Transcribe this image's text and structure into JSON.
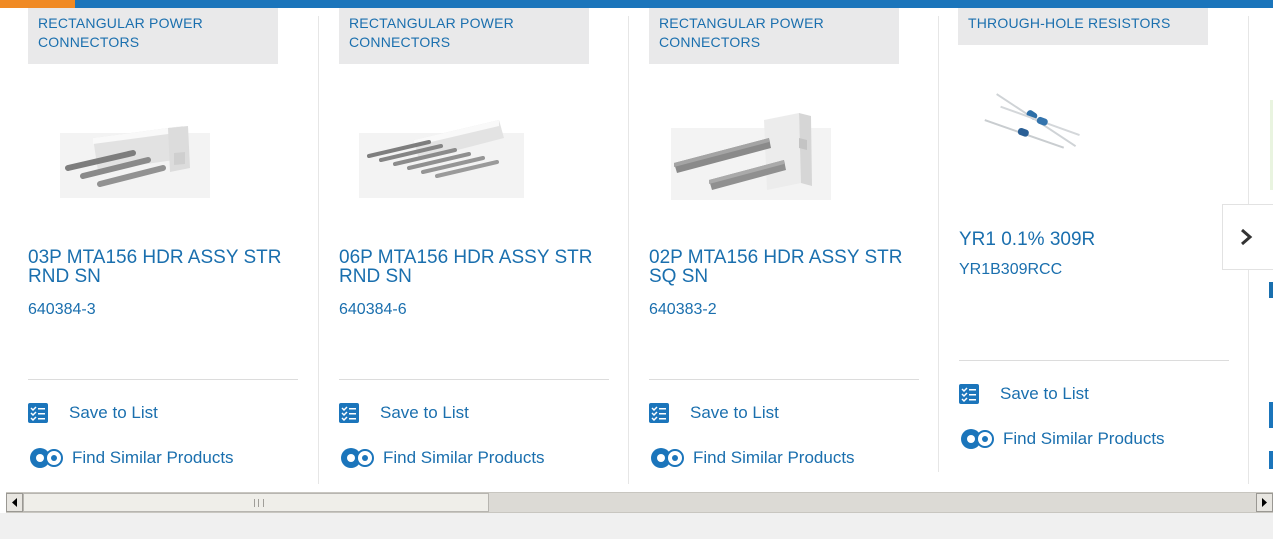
{
  "cards": [
    {
      "category": "RECTANGULAR POWER CONNECTORS",
      "name": "03P MTA156 HDR ASSY STR RND SN",
      "part_number": "640384-3",
      "save_label": "Save to List",
      "similar_label": "Find Similar Products"
    },
    {
      "category": "RECTANGULAR POWER CONNECTORS",
      "name": "06P MTA156 HDR ASSY STR RND SN",
      "part_number": "640384-6",
      "save_label": "Save to List",
      "similar_label": "Find Similar Products"
    },
    {
      "category": "RECTANGULAR POWER CONNECTORS",
      "name": "02P MTA156 HDR ASSY STR SQ SN",
      "part_number": "640383-2",
      "save_label": "Save to List",
      "similar_label": "Find Similar Products"
    },
    {
      "category": "THROUGH-HOLE RESISTORS",
      "name": "YR1 0.1% 309R",
      "part_number": "YR1B309RCC",
      "save_label": "Save to List",
      "similar_label": "Find Similar Products"
    }
  ],
  "icons": {
    "save": "checklist-icon",
    "similar": "gears-icon",
    "next": "chevron-right-icon",
    "scroll_left": "arrow-left-icon",
    "scroll_right": "arrow-right-icon"
  },
  "colors": {
    "accent_blue": "#1b75bb",
    "link_blue": "#1a6fae",
    "accent_orange": "#f08a24",
    "category_bg": "#e9e9ea"
  }
}
